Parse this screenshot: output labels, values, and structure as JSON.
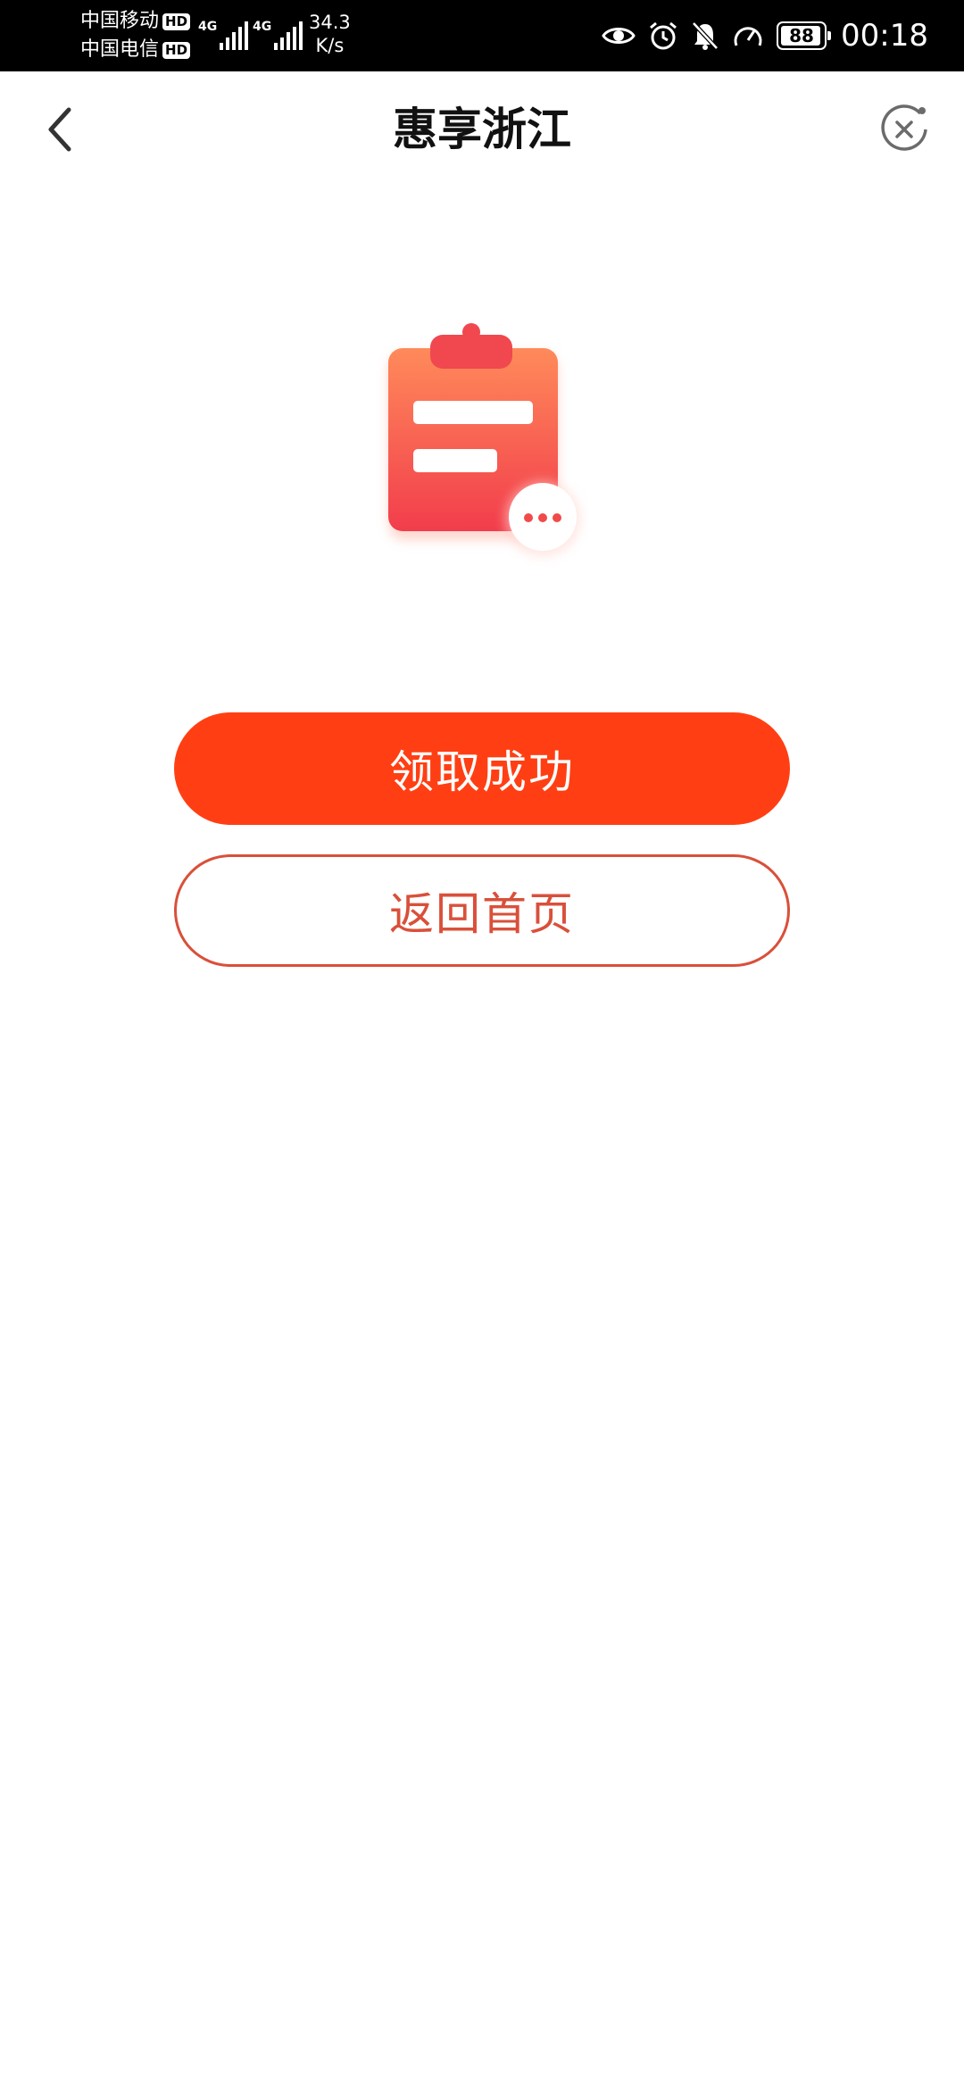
{
  "status_bar": {
    "carrier1": "中国移动",
    "carrier2": "中国电信",
    "hd_badge": "HD",
    "network1": "4G",
    "network2": "4G",
    "speed_value": "34.3",
    "speed_unit": "K/s",
    "battery": "88",
    "time": "00:18"
  },
  "nav": {
    "title": "惠享浙江"
  },
  "actions": {
    "primary_label": "领取成功",
    "secondary_label": "返回首页"
  },
  "colors": {
    "primary": "#ff3f13",
    "secondary_outline": "#d9503a",
    "status_bar_bg": "#000000"
  },
  "icons": {
    "back": "chevron-left-icon",
    "close": "close-circle-icon",
    "illustration": "clipboard-icon",
    "more": "more-dots-icon"
  }
}
